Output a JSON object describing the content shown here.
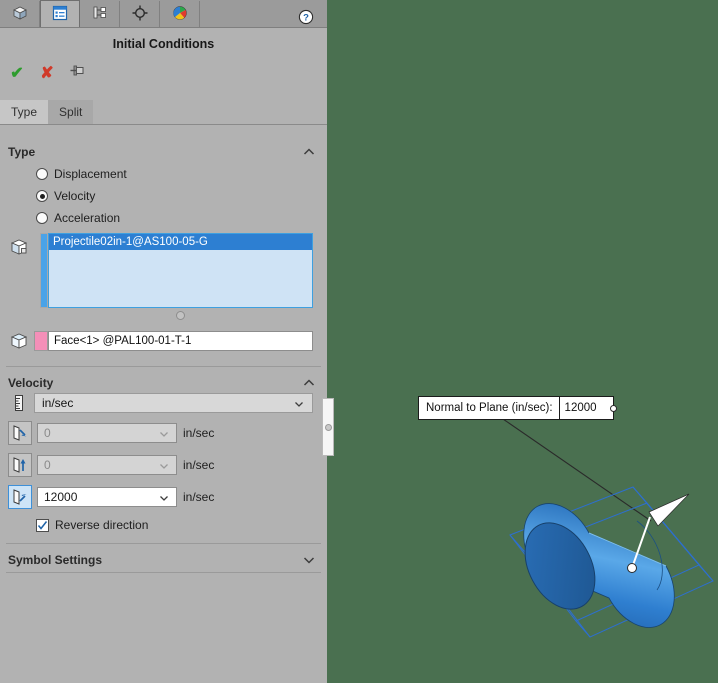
{
  "manager_tabs": [
    {
      "name": "feature-manager-tab",
      "icon": "cube-icon",
      "active": false
    },
    {
      "name": "property-manager-tab",
      "icon": "list-panel-icon",
      "active": true
    },
    {
      "name": "configuration-manager-tab",
      "icon": "configuration-tree-icon",
      "active": false
    },
    {
      "name": "display-manager-tab",
      "icon": "crosshair-icon",
      "active": false
    },
    {
      "name": "appearances-tab",
      "icon": "color-ball-icon",
      "active": false
    }
  ],
  "header": {
    "title": "Initial Conditions",
    "help_icon": "help-question-icon"
  },
  "actions": {
    "ok_label": "✔",
    "cancel_label": "✘",
    "pin_icon": "pushpin-icon"
  },
  "subtabs": [
    {
      "label": "Type",
      "active": true
    },
    {
      "label": "Split",
      "active": false
    }
  ],
  "type_section": {
    "title": "Type",
    "collapsed": false,
    "options": [
      {
        "label": "Displacement",
        "checked": false
      },
      {
        "label": "Velocity",
        "checked": true
      },
      {
        "label": "Acceleration",
        "checked": false
      }
    ],
    "selection_list": {
      "icon": "solid-body-icon",
      "swatch_color": "#4aa3e8",
      "items": [
        "Projectile02in-1@AS100-05-G"
      ]
    },
    "face_field": {
      "icon": "face-body-icon",
      "swatch_color": "#f48fb8",
      "value": "Face<1> @PAL100-01-T-1"
    }
  },
  "velocity_section": {
    "title": "Velocity",
    "collapsed": false,
    "unit_combo": {
      "icon": "ruler-icon",
      "value": "in/sec"
    },
    "components": [
      {
        "icon": "plane-arrow-downright-icon",
        "value": "0",
        "unit": "in/sec",
        "disabled": true,
        "selected": false
      },
      {
        "icon": "plane-arrow-up-icon",
        "value": "0",
        "unit": "in/sec",
        "disabled": true,
        "selected": false
      },
      {
        "icon": "plane-arrow-upright-icon",
        "value": "12000",
        "unit": "in/sec",
        "disabled": false,
        "selected": true
      }
    ],
    "reverse_direction": {
      "label": "Reverse direction",
      "checked": true
    }
  },
  "symbol_settings_section": {
    "title": "Symbol Settings",
    "collapsed": true
  },
  "viewport": {
    "background_color": "#4a7050",
    "callout": {
      "label": "Normal to Plane (in/sec):",
      "value": "12000"
    },
    "model": {
      "name": "projectile-cylinder",
      "body_color": "#2f7fd0",
      "selection_box_color": "#2d6fd0"
    }
  },
  "splitter": {
    "name": "panel-splitter-handle"
  }
}
